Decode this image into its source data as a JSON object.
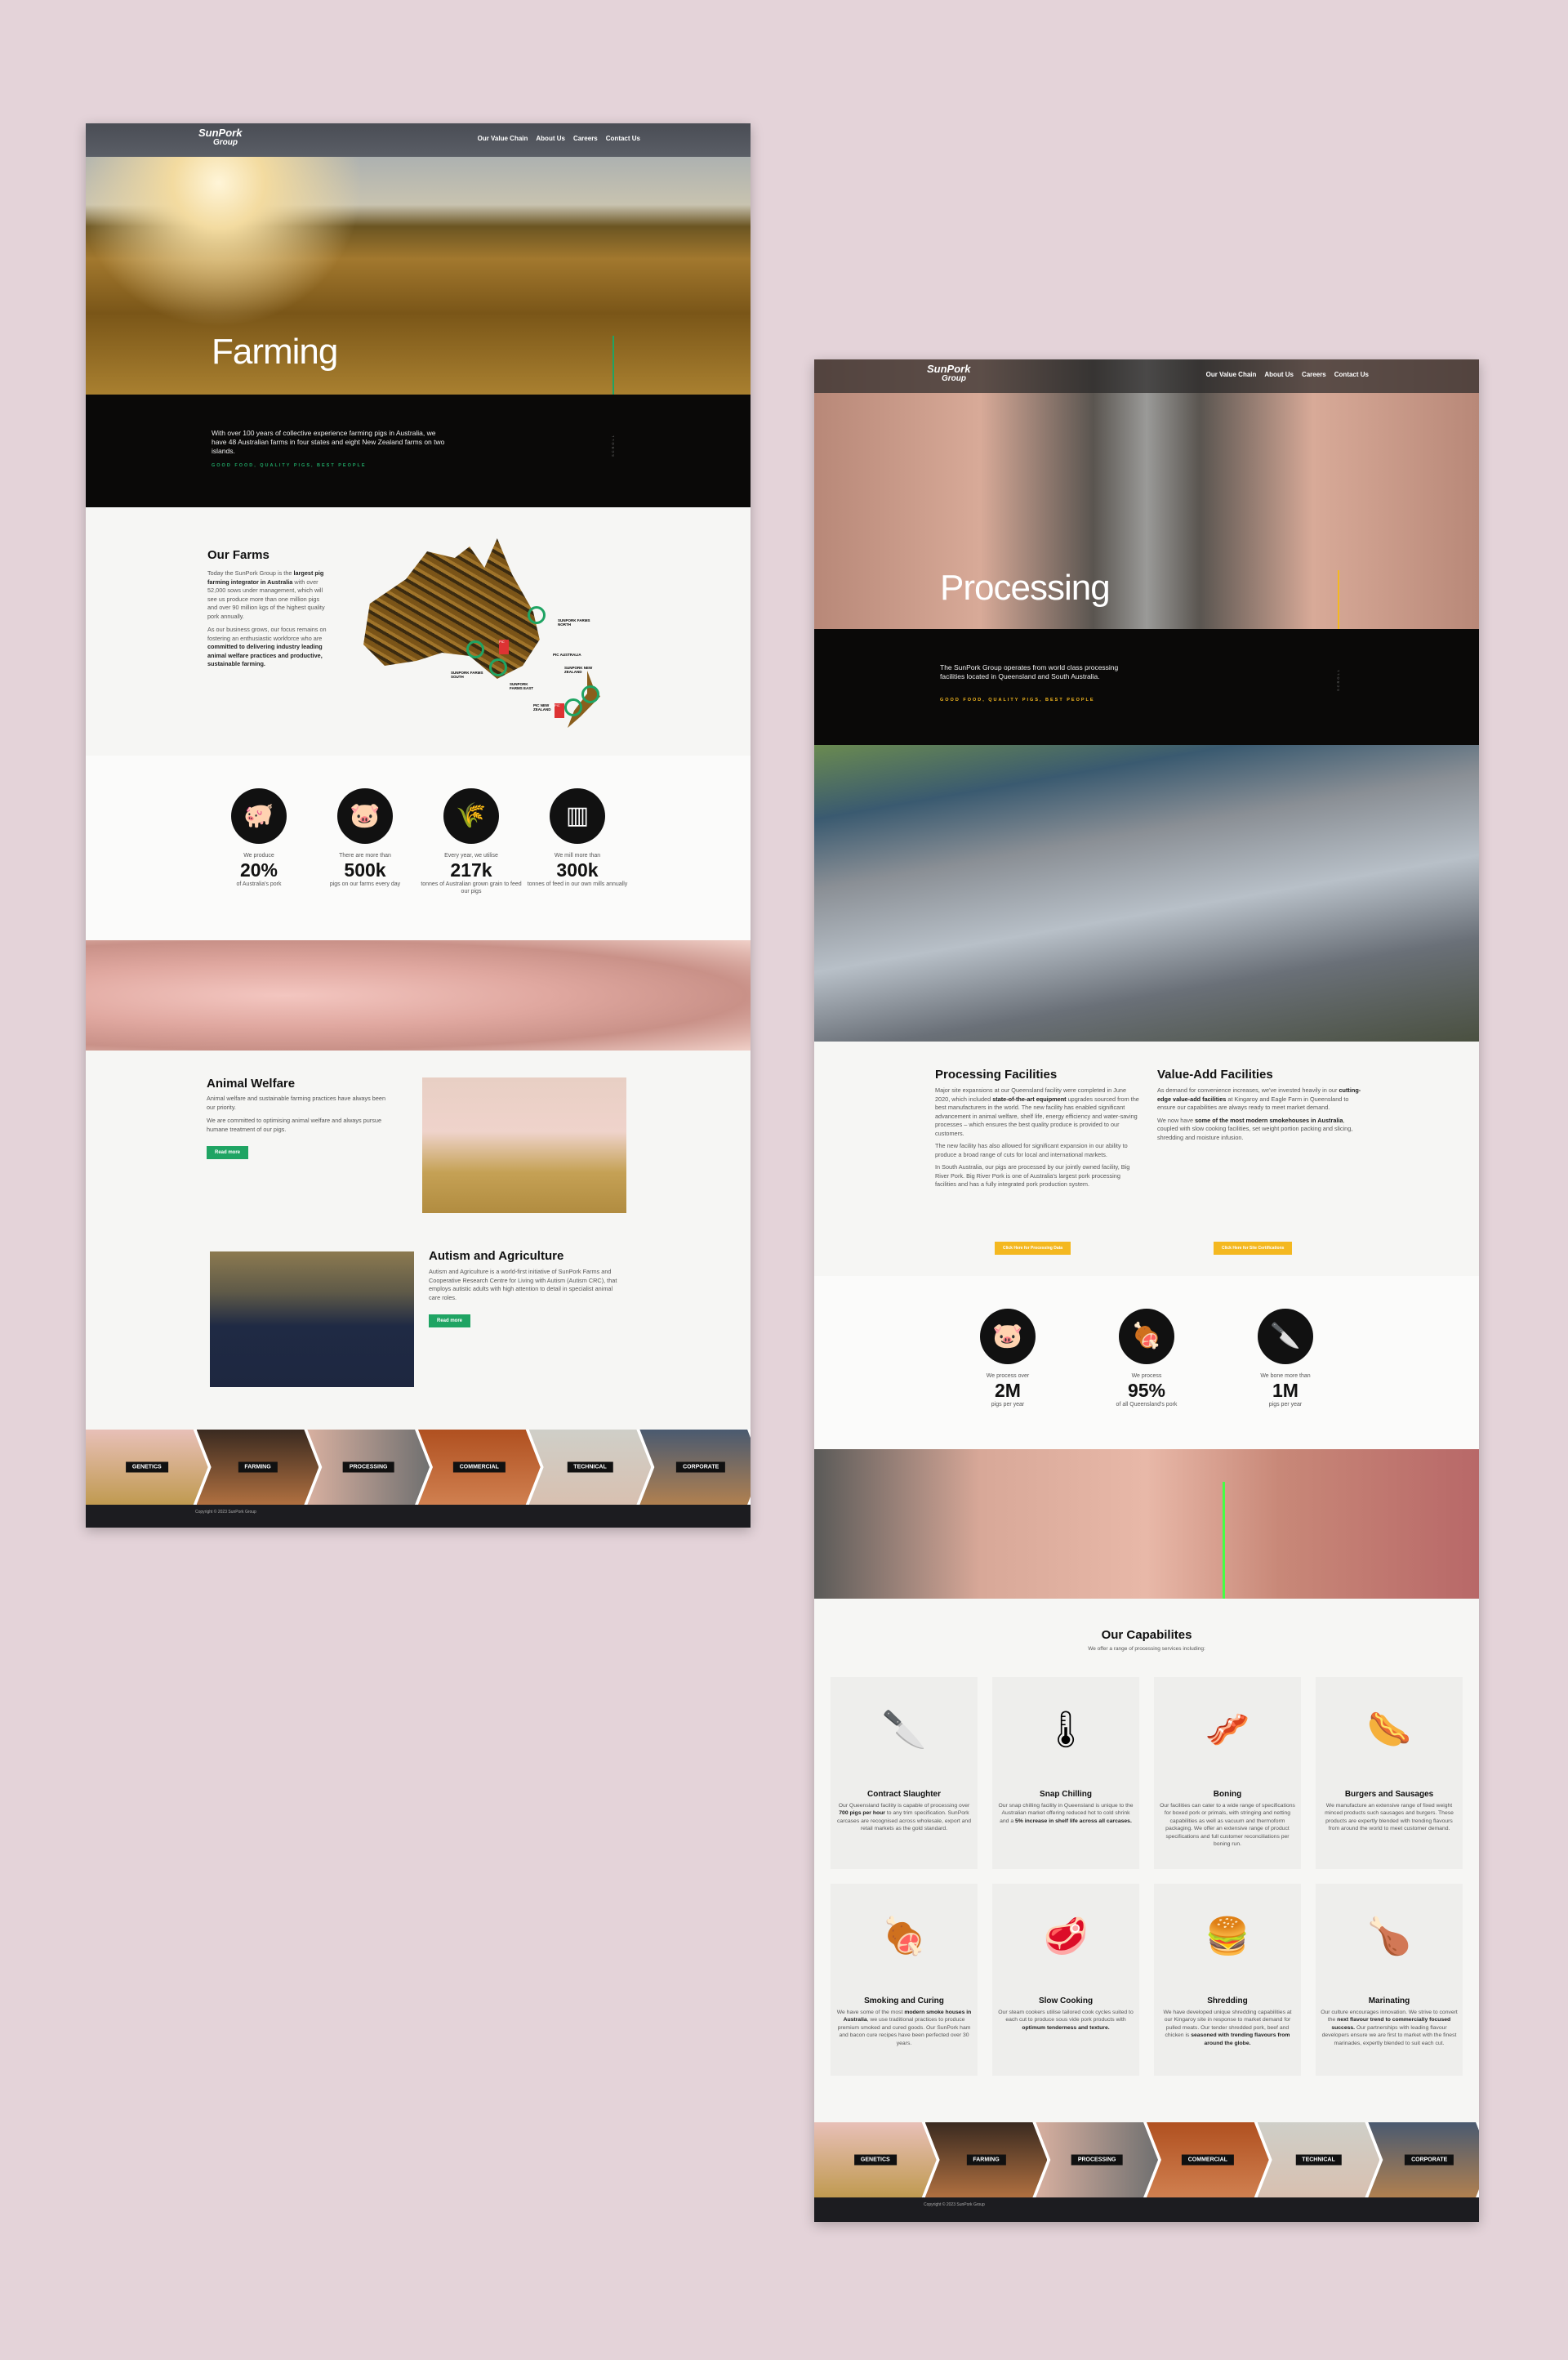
{
  "nav": {
    "logo": "SunPork Group",
    "logo_top": "SunPork",
    "logo_bottom": "Group",
    "items": [
      "Our Value Chain",
      "About Us",
      "Careers",
      "Contact Us"
    ]
  },
  "farming": {
    "title": "Farming",
    "intro": "With over 100 years of collective experience farming pigs in Australia, we have 48 Australian farms in four states and eight New Zealand farms on two islands.",
    "tagline": "GOOD FOOD, QUALITY PIGS, BEST PEOPLE",
    "scroll": "SCROLL",
    "accent": "#1fa463",
    "farms": {
      "title": "Our Farms",
      "p1_a": "Today the SunPork Group is the ",
      "p1_b": "largest pig farming integrator in Australia",
      "p1_c": " with over 52,000 sows under management, which will see us produce more than one million pigs and over 90 million kgs of the highest quality pork annually.",
      "p2_a": "As our business grows, our focus remains on fostering an enthusiastic workforce who are ",
      "p2_b": "committed to delivering industry leading animal welfare practices and productive, sustainable farming.",
      "map_labels": [
        "SUNPORK FARMS NORTH",
        "PIC AUSTRALIA",
        "SUNPORK FARMS SOUTH",
        "SUNPORK FARMS EAST",
        "SUNPORK NEW ZEALAND",
        "PIC NEW ZEALAND"
      ],
      "pic_badge": "PIC"
    },
    "stats": [
      {
        "icon": "pig-icon",
        "pre": "We produce",
        "num": "20%",
        "post": "of Australia's pork"
      },
      {
        "icon": "pigs-icon",
        "pre": "There are more than",
        "num": "500k",
        "post": "pigs on our farms every day"
      },
      {
        "icon": "wheat-icon",
        "pre": "Every year, we utilise",
        "num": "217k",
        "post": "tonnes of Australian grown grain to feed our pigs"
      },
      {
        "icon": "feed-mill-icon",
        "pre": "We mill more than",
        "num": "300k",
        "post": "tonnes of feed in our own mills annually"
      }
    ],
    "welfare": {
      "title": "Animal Welfare",
      "p1": "Animal welfare and sustainable farming practices have always been our priority.",
      "p2": "We are committed to optimising animal welfare and always pursue humane treatment of our pigs.",
      "button": "Read more"
    },
    "autism": {
      "title": "Autism and Agriculture",
      "p1": "Autism and Agriculture is a world-first initiative of SunPork Farms and Cooperative Research Centre for Living with Autism (Autism CRC), that employs autistic adults with high attention to detail in specialist animal care roles.",
      "button": "Read more"
    }
  },
  "categories": [
    "GENETICS",
    "FARMING",
    "PROCESSING",
    "COMMERCIAL",
    "TECHNICAL",
    "CORPORATE"
  ],
  "copyright": "Copyright © 2023 SunPork Group",
  "processing": {
    "title": "Processing",
    "intro": "The SunPork Group operates from world class processing facilities located in Queensland and South Australia.",
    "tagline": "GOOD FOOD, QUALITY PIGS, BEST PEOPLE",
    "scroll": "SCROLL",
    "accent": "#f4b820",
    "facilities": {
      "title": "Processing Facilities",
      "p1_a": "Major site expansions at our Queensland facility were completed in June 2020, which included ",
      "p1_b": "state-of-the-art equipment",
      "p1_c": " upgrades sourced from the best manufacturers in the world. The new facility has enabled significant advancement in animal welfare, shelf life, energy efficiency and water-saving processes – which ensures the best quality produce is provided to our customers.",
      "p2": "The new facility has also allowed for significant expansion in our ability to produce a broad range of cuts for local and international markets.",
      "p3": "In South Australia, our pigs are processed by our jointly owned facility, Big River Pork. Big River Pork is one of Australia's largest pork processing facilities and has a fully integrated pork production system.",
      "button": "Click Here for Processing Data"
    },
    "valueadd": {
      "title": "Value-Add Facilities",
      "p1_a": "As demand for convenience increases, we've invested heavily in our ",
      "p1_b": "cutting-edge value-add facilities",
      "p1_c": " at Kingaroy and Eagle Farm in Queensland to ensure our capabilities are always ready to meet market demand.",
      "p2_a": "We now have ",
      "p2_b": "some of the most modern smokehouses in Australia",
      "p2_c": ", coupled with slow cooking facilities, set weight portion packing and slicing, shredding and moisture infusion.",
      "button": "Click Here for Site Certifications"
    },
    "stats": [
      {
        "icon": "pigs-icon",
        "pre": "We process over",
        "num": "2M",
        "post": "pigs per year"
      },
      {
        "icon": "pork-chop-icon",
        "pre": "We process",
        "num": "95%",
        "post": "of all Queensland's pork"
      },
      {
        "icon": "cleaver-knife-icon",
        "pre": "We bone more than",
        "num": "1M",
        "post": "pigs per year"
      }
    ],
    "capabilities": {
      "title": "Our Capabilites",
      "subtitle": "We offer a range of processing services including:",
      "cards": [
        {
          "title": "Contract Slaughter",
          "a": "Our Queensland facility is capable of processing over ",
          "b": "700 pigs per hour",
          "c": " to any trim specification. SunPork carcases are recognised across wholesale, export and retail markets as the gold standard.",
          "icon": "knives-icon"
        },
        {
          "title": "Snap Chilling",
          "a": "Our snap chilling facility in Queensland is unique to the Australian market offering reduced hot to cold shrink and a ",
          "b": "5% increase in shelf life across all carcases.",
          "c": "",
          "icon": "thermometer-icon"
        },
        {
          "title": "Boning",
          "a": "Our facilities can cater to a wide range of specifications for boxed pork or primals, with stringing and netting capabilities as well as vacuum and thermoform packaging. We offer an extensive range of product specifications and full customer reconciliations per boning run.",
          "b": "",
          "c": "",
          "icon": "pork-belly-icon"
        },
        {
          "title": "Burgers and Sausages",
          "a": "We manufacture an extensive range of fixed weight minced products such sausages and burgers. These products are expertly blended with trending flavours from around the world to meet customer demand.",
          "b": "",
          "c": "",
          "icon": "sausages-icon"
        },
        {
          "title": "Smoking and Curing",
          "a": "We have some of the most ",
          "b": "modern smoke houses in Australia",
          "c": ", we use traditional practices to produce premium smoked and cured goods. Our SunPork ham and bacon cure recipes have been perfected over 30 years.",
          "icon": "ham-icon"
        },
        {
          "title": "Slow Cooking",
          "a": "Our steam cookers utilise tailored cook cycles suited to each cut to produce sous vide pork products with ",
          "b": "optimum tenderness and texture.",
          "c": "",
          "icon": "ribs-icon"
        },
        {
          "title": "Shredding",
          "a": "We have developed unique shredding capabilities at our Kingaroy site in response to market demand for pulled meats. Our tender shredded pork, beef and chicken is ",
          "b": "seasoned with trending flavours from around the globe.",
          "c": "",
          "icon": "burger-icon"
        },
        {
          "title": "Marinating",
          "a": "Our culture encourages innovation. We strive to convert the ",
          "b": "next flavour trend to commercially focused success.",
          "c": " Our partnerships with leading flavour developers ensure we are first to market with the finest marinades, expertly blended to suit each cut.",
          "icon": "marinated-roast-icon"
        }
      ]
    }
  }
}
